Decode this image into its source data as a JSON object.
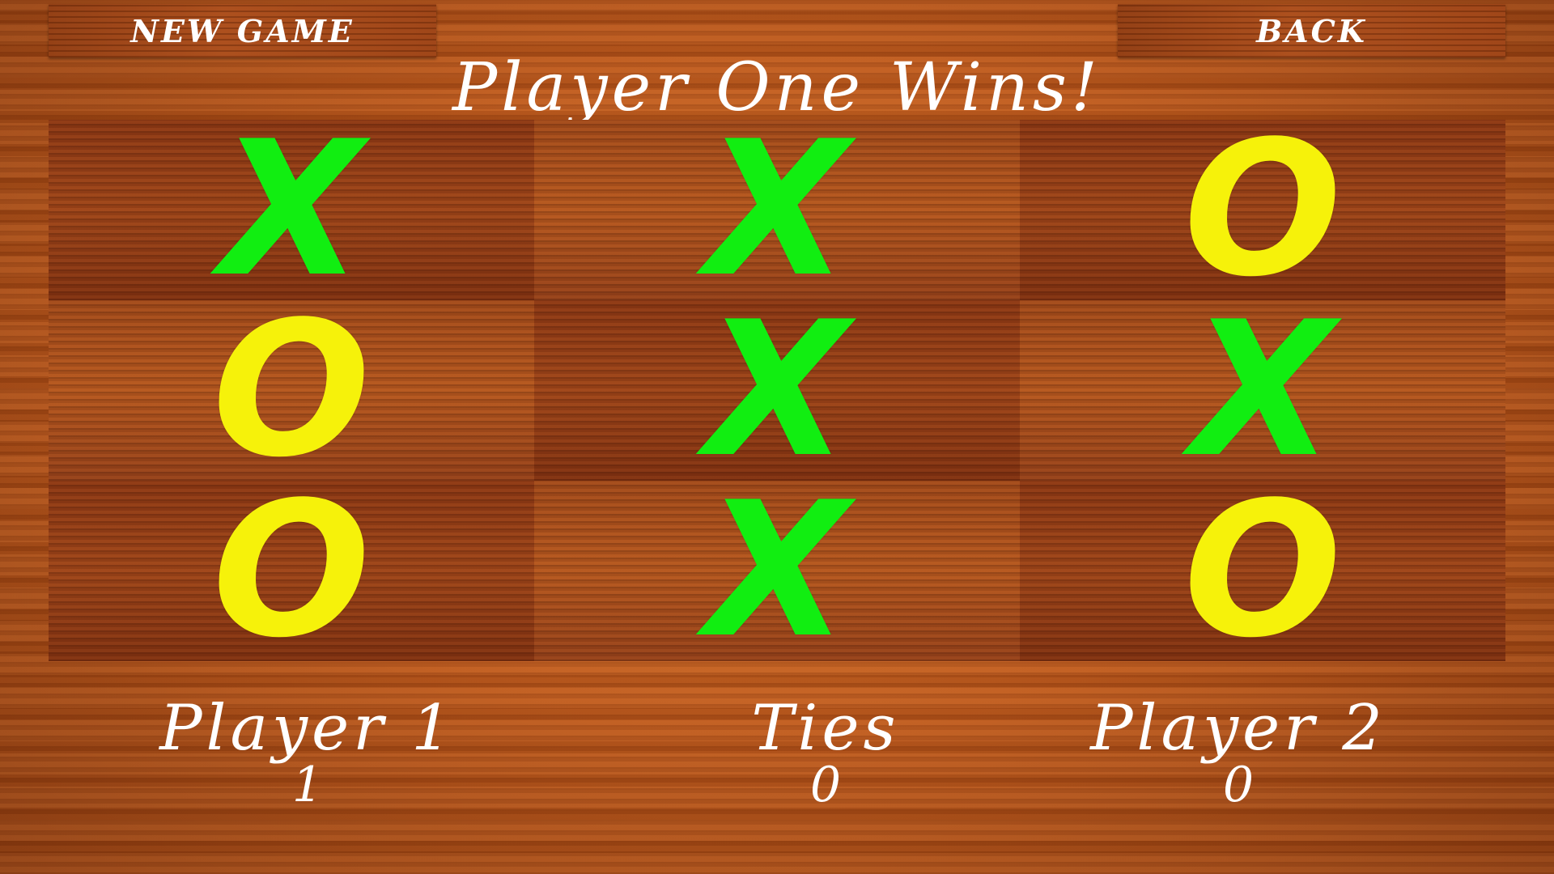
{
  "toolbar": {
    "new_game_label": "NEW GAME",
    "back_label": "BACK"
  },
  "status": {
    "message": "Player One Wins!"
  },
  "board": {
    "cells": [
      [
        "X",
        "X",
        "O"
      ],
      [
        "O",
        "X",
        "X"
      ],
      [
        "O",
        "X",
        "O"
      ]
    ]
  },
  "scoreboard": {
    "player1": {
      "label": "Player 1",
      "value": "1"
    },
    "ties": {
      "label": "Ties",
      "value": "0"
    },
    "player2": {
      "label": "Player 2",
      "value": "0"
    }
  },
  "colors": {
    "x_mark": "#11ee11",
    "o_mark": "#f6f20a",
    "text": "#ffffff"
  }
}
